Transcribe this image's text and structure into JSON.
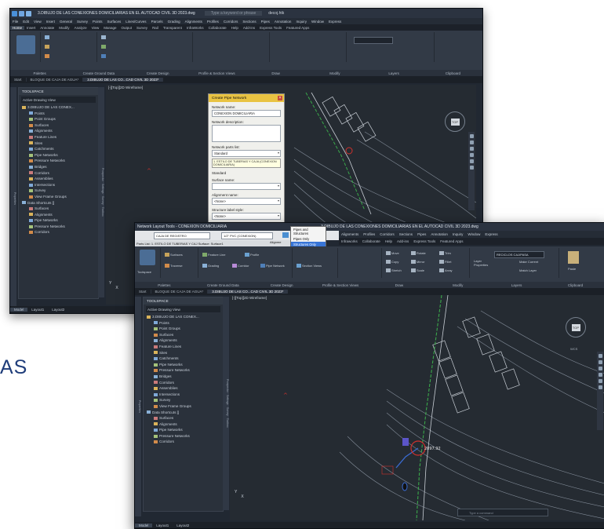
{
  "background": {
    "partial_text": "AS"
  },
  "window1": {
    "title": "3.DIBUJO DE LAS CONEXIONES DOMICILIARIAS EN EL AUTOCAD CIVIL 3D 2023.dwg",
    "search_placeholder": "Type a keyword or phrase",
    "user": "decoj.htk",
    "menus": [
      "File",
      "Edit",
      "View",
      "Insert",
      "General",
      "Survey",
      "Points",
      "Surfaces",
      "Lines/Curves",
      "Parcels",
      "Grading",
      "Alignments",
      "Profiles",
      "Corridors",
      "Sections",
      "Pipes",
      "Annotation",
      "Inquiry",
      "Window",
      "Express"
    ],
    "ribbon_tabs": [
      "Home",
      "Insert",
      "Annotate",
      "Modify",
      "Analyze",
      "View",
      "Manage",
      "Output",
      "Survey",
      "Rail",
      "Transparent",
      "InfraWorks",
      "Collaborate",
      "Help",
      "Add-ins",
      "Express Tools",
      "Featured Apps"
    ],
    "active_ribbon_tab": "Home",
    "panels": [
      "Palettes",
      "Create Ground Data",
      "Create Design",
      "Profile & Section Views",
      "Draw",
      "Modify",
      "Layers",
      "Clipboard"
    ],
    "doc_tabs": [
      "Start",
      "BLOQUE DE CAJA DE AGUA*",
      "3.DIBUJO DE LAS CO...CAD CIVIL 3D 2023*"
    ],
    "active_doc_tab": 2,
    "viewport_label": "[-][Top][2D Wireframe]",
    "status_tabs": [
      "Model",
      "Layout1",
      "Layout2"
    ],
    "active_status_tab": "Model"
  },
  "toolspace": {
    "title": "TOOLSPACE",
    "view": "Active Drawing View",
    "items": [
      {
        "label": "3.DIBUJO DE LAS CONEX...",
        "level": 0
      },
      {
        "label": "Points",
        "level": 1
      },
      {
        "label": "Point Groups",
        "level": 1
      },
      {
        "label": "Surfaces",
        "level": 1
      },
      {
        "label": "Alignments",
        "level": 1
      },
      {
        "label": "Feature Lines",
        "level": 1
      },
      {
        "label": "Sites",
        "level": 1
      },
      {
        "label": "Catchments",
        "level": 1
      },
      {
        "label": "Pipe Networks",
        "level": 1
      },
      {
        "label": "Pressure Networks",
        "level": 1
      },
      {
        "label": "Bridges",
        "level": 1
      },
      {
        "label": "Corridors",
        "level": 1
      },
      {
        "label": "Assemblies",
        "level": 1
      },
      {
        "label": "Intersections",
        "level": 1
      },
      {
        "label": "Survey",
        "level": 1
      },
      {
        "label": "View Frame Groups",
        "level": 1
      },
      {
        "label": "Data Shortcuts []",
        "level": 0
      },
      {
        "label": "Surfaces",
        "level": 1
      },
      {
        "label": "Alignments",
        "level": 1
      },
      {
        "label": "Pipe Networks",
        "level": 1
      },
      {
        "label": "Pressure Networks",
        "level": 1
      },
      {
        "label": "Corridors",
        "level": 1
      }
    ],
    "side_tabs": [
      "Prospector",
      "Settings",
      "Survey",
      "Toolbox"
    ],
    "left_tab": "Properties"
  },
  "dialog": {
    "title": "Create Pipe Network",
    "network_name_label": "Network name:",
    "network_name": "CONEXION DOMICILIARIA",
    "description_label": "Network description:",
    "parts_list_label": "Network parts list:",
    "parts_list_value": "Standard",
    "tooltip": "1. ESTILO DE TUBERIAS Y CAJA (CONEXION DOMICILIARIA)",
    "standard_label": "Standard",
    "surface_label": "Surface name:",
    "alignment_label": "Alignment name:",
    "alignment_value": "<None>",
    "structure_style_label": "Structure label style:",
    "structure_style_value": "<None>",
    "pipe_style_label": "Pipe label style:"
  },
  "window2": {
    "title": "3.DIBUJO DE LAS CONEXIONES DOMICILIARIAS EN EL AUTOCAD CIVIL 3D 2023.dwg",
    "layout_tools": "Network Layout Tools - CONEXION DOMICILIARIA",
    "structure_combo": "CAJA DE REGISTRO",
    "pipe_combo": "1/2\" PVC (CONEXION)",
    "item_list": "Parts List: 1. ESTILO DE TUBERIAS Y CAJ   Surface: Surface1",
    "alignment_label": "Alignme",
    "dropdown_options": [
      "Pipes and Structures",
      "Pipes Only",
      "Structures Only"
    ],
    "dropdown_selected": 2,
    "menus": [
      "Alignments",
      "Profiles",
      "Corridors",
      "Sections",
      "Pipes",
      "Annotation",
      "Inquiry",
      "Window",
      "Express"
    ],
    "ribbon_tabs": [
      "Infraworks",
      "Collaborate",
      "Help",
      "Add-ins",
      "Express Tools",
      "Featured Apps"
    ],
    "tools": {
      "toolspace": "Toolspace",
      "surfaces": "Surfaces",
      "feature_line": "Feature Line",
      "profile": "Profile",
      "traverse": "Traverse",
      "grading": "Grading",
      "corridor": "Corridor",
      "pipe_network": "Pipe Network",
      "section_views": "Section Views",
      "move": "Move",
      "rotate": "Rotate",
      "trim": "Trim",
      "copy": "Copy",
      "mirror": "Mirror",
      "fillet": "Fillet",
      "stretch": "Stretch",
      "scale": "Scale",
      "array": "Array",
      "layer_props": "Layer Properties",
      "make_current": "Make Current",
      "match_layer": "Match Layer",
      "paste": "Paste",
      "layer_name": "RECICLOS CAJ/PASA"
    },
    "panels": [
      "Palettes",
      "Create Ground Data",
      "Create Design",
      "Profile & Section Views",
      "Draw",
      "Modify",
      "Layers",
      "Clipboard"
    ],
    "doc_tabs": [
      "Start",
      "BLOQUE DE CAJA DE AGUA*",
      "3.DIBUJO DE LAS CO...CAD CIVIL 3D 2023*"
    ],
    "viewport_label": "[-][Top][2D Wireframe]",
    "command_placeholder": "Type a command",
    "status_tabs": [
      "Model",
      "Layout1",
      "Layout2"
    ],
    "ucs_y": "Y",
    "ucs_x": "X",
    "structure_tag": "2097.92",
    "cube_face": "TOP",
    "compass": {
      "n": "N",
      "s": "S",
      "e": "E",
      "w": "W"
    },
    "wcs": "WCS"
  },
  "colors": {
    "accent": "#e9c342",
    "app_bg": "#212832",
    "viewport": "#252b32",
    "contour": "#8c96a3",
    "highlight": "#3875d7",
    "red": "#d0312d"
  }
}
